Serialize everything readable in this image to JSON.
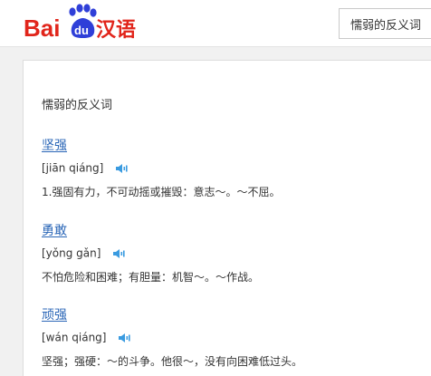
{
  "header": {
    "logo": {
      "text_bai": "Bai",
      "text_du": "du",
      "text_cn": "汉语"
    },
    "search": {
      "value": "懦弱的反义词"
    }
  },
  "main": {
    "title": "懦弱的反义词",
    "entries": [
      {
        "word": "坚强",
        "pinyin": "[jiān qiáng]",
        "definition": "1.强固有力，不可动摇或摧毁：意志～。～不屈。"
      },
      {
        "word": "勇敢",
        "pinyin": "[yǒng gǎn]",
        "definition": "不怕危险和困难；有胆量：机智～。～作战。"
      },
      {
        "word": "顽强",
        "pinyin": "[wán qiáng]",
        "definition": "坚强；强硬：～的斗争。他很～，没有向困难低过头。"
      }
    ]
  },
  "colors": {
    "brand_red": "#e1251b",
    "brand_blue": "#2f3fd8",
    "link": "#2a66b7",
    "speaker": "#3a9be0"
  },
  "icons": {
    "logo": "baidu-paw-logo",
    "speaker": "speaker-icon"
  }
}
